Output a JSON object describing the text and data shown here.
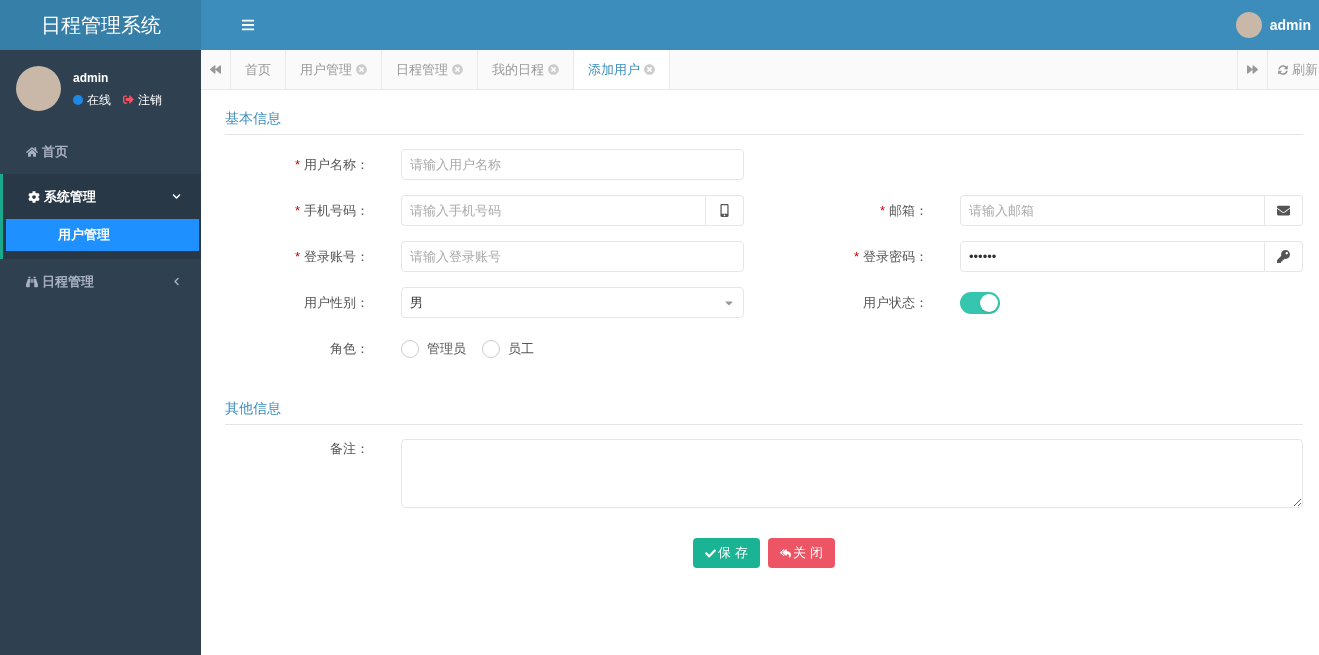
{
  "header": {
    "logo": "日程管理系统",
    "user": "admin"
  },
  "sidebar": {
    "user": {
      "name": "admin",
      "status": "在线",
      "logout": "注销"
    },
    "items": [
      {
        "label": "首页",
        "selected": false
      },
      {
        "label": "系统管理",
        "selected": false,
        "expanded": true,
        "children": [
          {
            "label": "用户管理",
            "selected": true
          }
        ]
      },
      {
        "label": "日程管理",
        "selected": false,
        "expanded": false
      }
    ]
  },
  "tabs": [
    {
      "label": "首页",
      "selected": false,
      "closable": false
    },
    {
      "label": "用户管理",
      "selected": false,
      "closable": true
    },
    {
      "label": "日程管理",
      "selected": false,
      "closable": true
    },
    {
      "label": "我的日程",
      "selected": false,
      "closable": true
    },
    {
      "label": "添加用户",
      "selected": true,
      "closable": true
    }
  ],
  "refresh": "刷新",
  "sections": [
    {
      "title": "基本信息",
      "rows": [
        [
          {
            "kind": "text",
            "label": "用户名称：",
            "required_mark": "*",
            "placeholder": "请输入用户名称"
          }
        ],
        [
          {
            "kind": "phone",
            "label": "手机号码：",
            "required_mark": "*",
            "placeholder": "请输入手机号码"
          },
          {
            "kind": "email",
            "label": "邮箱：",
            "required_mark": "*",
            "placeholder": "请输入邮箱"
          }
        ],
        [
          {
            "kind": "text",
            "label": "登录账号：",
            "required_mark": "*",
            "placeholder": "请输入登录账号"
          },
          {
            "kind": "password",
            "label": "登录密码：",
            "required_mark": "*",
            "value": "••••••"
          }
        ],
        [
          {
            "kind": "select",
            "label": "用户性别：",
            "value": "男"
          },
          {
            "kind": "switch",
            "label": "用户状态：",
            "on": true
          }
        ],
        [
          {
            "kind": "radio",
            "label": "角色：",
            "options": [
              {
                "label": "管理员",
                "selected": false
              },
              {
                "label": "员工",
                "selected": false
              }
            ]
          }
        ]
      ]
    },
    {
      "title": "其他信息",
      "rows": [
        [
          {
            "kind": "textarea",
            "label": "备注："
          }
        ]
      ]
    }
  ],
  "buttons": [
    {
      "kind": "save",
      "label": "保 存"
    },
    {
      "kind": "close",
      "label": "关 闭"
    }
  ]
}
